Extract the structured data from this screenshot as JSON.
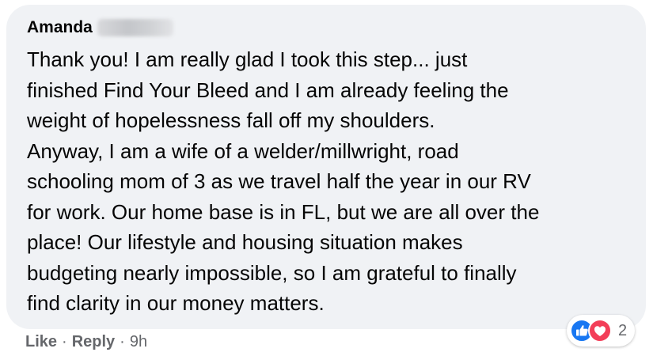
{
  "comment": {
    "author": "Amanda",
    "text": "Thank you! I am really glad I took this step... just\nfinished Find Your Bleed and I am already feeling the\nweight of hopelessness fall off my shoulders.\nAnyway, I am a wife of a welder/millwright, road\nschooling mom of 3 as we travel half the year in our RV\nfor work. Our home base is in FL, but we are all over the\nplace! Our lifestyle and housing situation makes\nbudgeting nearly impossible, so I am grateful to finally\nfind clarity in our money matters."
  },
  "actions": {
    "like": "Like",
    "separator": "·",
    "reply": "Reply",
    "time": "9h"
  },
  "reactions": {
    "icons": [
      "like-icon",
      "love-icon"
    ],
    "count": "2",
    "colors": {
      "like": "#1877f2",
      "love": "#f33e58"
    }
  },
  "colors": {
    "bubble": "#f0f2f5",
    "text": "#050505",
    "secondary": "#65676b"
  }
}
